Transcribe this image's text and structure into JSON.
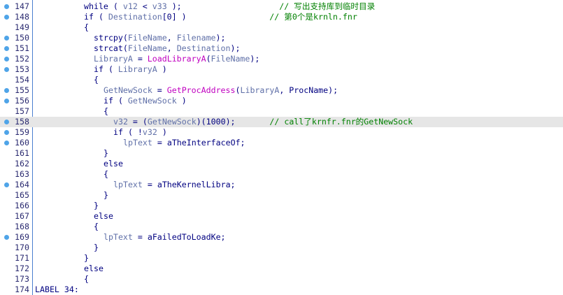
{
  "lines": [
    {
      "n": "147",
      "bp": true,
      "hl": false,
      "indent": 5,
      "tokens": [
        {
          "t": "while",
          "c": "k"
        },
        {
          "t": " ( ",
          "c": "p"
        },
        {
          "t": "v12",
          "c": "v"
        },
        {
          "t": " < ",
          "c": "p"
        },
        {
          "t": "v33",
          "c": "v"
        },
        {
          "t": " );",
          "c": "p"
        },
        {
          "t": "                    ",
          "c": "p"
        },
        {
          "t": "// 写出支持库到临时目录",
          "c": "c"
        }
      ]
    },
    {
      "n": "148",
      "bp": true,
      "hl": false,
      "indent": 5,
      "tokens": [
        {
          "t": "if",
          "c": "k"
        },
        {
          "t": " ( ",
          "c": "p"
        },
        {
          "t": "Destination",
          "c": "v"
        },
        {
          "t": "[0] )",
          "c": "p"
        },
        {
          "t": "                 ",
          "c": "p"
        },
        {
          "t": "// 第0个是krnln.fnr",
          "c": "c"
        }
      ]
    },
    {
      "n": "149",
      "bp": false,
      "hl": false,
      "indent": 5,
      "tokens": [
        {
          "t": "{",
          "c": "p"
        }
      ]
    },
    {
      "n": "150",
      "bp": true,
      "hl": false,
      "indent": 6,
      "tokens": [
        {
          "t": "strcpy",
          "c": "k"
        },
        {
          "t": "(",
          "c": "p"
        },
        {
          "t": "FileName",
          "c": "v"
        },
        {
          "t": ", ",
          "c": "p"
        },
        {
          "t": "Filename",
          "c": "v"
        },
        {
          "t": ");",
          "c": "p"
        }
      ]
    },
    {
      "n": "151",
      "bp": true,
      "hl": false,
      "indent": 6,
      "tokens": [
        {
          "t": "strcat",
          "c": "k"
        },
        {
          "t": "(",
          "c": "p"
        },
        {
          "t": "FileName",
          "c": "v"
        },
        {
          "t": ", ",
          "c": "p"
        },
        {
          "t": "Destination",
          "c": "v"
        },
        {
          "t": ");",
          "c": "p"
        }
      ]
    },
    {
      "n": "152",
      "bp": true,
      "hl": false,
      "indent": 6,
      "tokens": [
        {
          "t": "LibraryA",
          "c": "v"
        },
        {
          "t": " = ",
          "c": "p"
        },
        {
          "t": "LoadLibraryA",
          "c": "f"
        },
        {
          "t": "(",
          "c": "p"
        },
        {
          "t": "FileName",
          "c": "v"
        },
        {
          "t": ");",
          "c": "p"
        }
      ]
    },
    {
      "n": "153",
      "bp": true,
      "hl": false,
      "indent": 6,
      "tokens": [
        {
          "t": "if",
          "c": "k"
        },
        {
          "t": " ( ",
          "c": "p"
        },
        {
          "t": "LibraryA",
          "c": "v"
        },
        {
          "t": " )",
          "c": "p"
        }
      ]
    },
    {
      "n": "154",
      "bp": false,
      "hl": false,
      "indent": 6,
      "tokens": [
        {
          "t": "{",
          "c": "p"
        }
      ]
    },
    {
      "n": "155",
      "bp": true,
      "hl": false,
      "indent": 7,
      "tokens": [
        {
          "t": "GetNewSock",
          "c": "v"
        },
        {
          "t": " = ",
          "c": "p"
        },
        {
          "t": "GetProcAddress",
          "c": "f"
        },
        {
          "t": "(",
          "c": "p"
        },
        {
          "t": "LibraryA",
          "c": "v"
        },
        {
          "t": ", ",
          "c": "p"
        },
        {
          "t": "ProcName",
          "c": "k"
        },
        {
          "t": ");",
          "c": "p"
        }
      ]
    },
    {
      "n": "156",
      "bp": true,
      "hl": false,
      "indent": 7,
      "tokens": [
        {
          "t": "if",
          "c": "k"
        },
        {
          "t": " ( ",
          "c": "p"
        },
        {
          "t": "GetNewSock",
          "c": "v"
        },
        {
          "t": " )",
          "c": "p"
        }
      ]
    },
    {
      "n": "157",
      "bp": false,
      "hl": false,
      "indent": 7,
      "tokens": [
        {
          "t": "{",
          "c": "p"
        }
      ]
    },
    {
      "n": "158",
      "bp": true,
      "hl": true,
      "indent": 8,
      "tokens": [
        {
          "t": "v32",
          "c": "v"
        },
        {
          "t": " = (",
          "c": "p"
        },
        {
          "t": "GetNewSock",
          "c": "v"
        },
        {
          "t": ")(1000);",
          "c": "p"
        },
        {
          "t": "       ",
          "c": "p"
        },
        {
          "t": "// call了krnfr.fnr的GetNewSock",
          "c": "c"
        }
      ]
    },
    {
      "n": "159",
      "bp": true,
      "hl": false,
      "indent": 8,
      "tokens": [
        {
          "t": "if",
          "c": "k"
        },
        {
          "t": " ( !",
          "c": "p"
        },
        {
          "t": "v32",
          "c": "v"
        },
        {
          "t": " )",
          "c": "p"
        }
      ]
    },
    {
      "n": "160",
      "bp": true,
      "hl": false,
      "indent": 9,
      "tokens": [
        {
          "t": "lpText",
          "c": "v"
        },
        {
          "t": " = ",
          "c": "p"
        },
        {
          "t": "aTheInterfaceOf",
          "c": "k"
        },
        {
          "t": ";",
          "c": "p"
        }
      ]
    },
    {
      "n": "161",
      "bp": false,
      "hl": false,
      "indent": 7,
      "tokens": [
        {
          "t": "}",
          "c": "p"
        }
      ]
    },
    {
      "n": "162",
      "bp": false,
      "hl": false,
      "indent": 7,
      "tokens": [
        {
          "t": "else",
          "c": "k"
        }
      ]
    },
    {
      "n": "163",
      "bp": false,
      "hl": false,
      "indent": 7,
      "tokens": [
        {
          "t": "{",
          "c": "p"
        }
      ]
    },
    {
      "n": "164",
      "bp": true,
      "hl": false,
      "indent": 8,
      "tokens": [
        {
          "t": "lpText",
          "c": "v"
        },
        {
          "t": " = ",
          "c": "p"
        },
        {
          "t": "aTheKernelLibra",
          "c": "k"
        },
        {
          "t": ";",
          "c": "p"
        }
      ]
    },
    {
      "n": "165",
      "bp": false,
      "hl": false,
      "indent": 7,
      "tokens": [
        {
          "t": "}",
          "c": "p"
        }
      ]
    },
    {
      "n": "166",
      "bp": false,
      "hl": false,
      "indent": 6,
      "tokens": [
        {
          "t": "}",
          "c": "p"
        }
      ]
    },
    {
      "n": "167",
      "bp": false,
      "hl": false,
      "indent": 6,
      "tokens": [
        {
          "t": "else",
          "c": "k"
        }
      ]
    },
    {
      "n": "168",
      "bp": false,
      "hl": false,
      "indent": 6,
      "tokens": [
        {
          "t": "{",
          "c": "p"
        }
      ]
    },
    {
      "n": "169",
      "bp": true,
      "hl": false,
      "indent": 7,
      "tokens": [
        {
          "t": "lpText",
          "c": "v"
        },
        {
          "t": " = ",
          "c": "p"
        },
        {
          "t": "aFailedToLoadKe",
          "c": "k"
        },
        {
          "t": ";",
          "c": "p"
        }
      ]
    },
    {
      "n": "170",
      "bp": false,
      "hl": false,
      "indent": 6,
      "tokens": [
        {
          "t": "}",
          "c": "p"
        }
      ]
    },
    {
      "n": "171",
      "bp": false,
      "hl": false,
      "indent": 5,
      "tokens": [
        {
          "t": "}",
          "c": "p"
        }
      ]
    },
    {
      "n": "172",
      "bp": false,
      "hl": false,
      "indent": 5,
      "tokens": [
        {
          "t": "else",
          "c": "k"
        }
      ]
    },
    {
      "n": "173",
      "bp": false,
      "hl": false,
      "indent": 5,
      "tokens": [
        {
          "t": "{",
          "c": "p"
        }
      ]
    },
    {
      "n": "174",
      "bp": false,
      "hl": false,
      "indent": 0,
      "tokens": [
        {
          "t": "LABEL 34:",
          "c": "k"
        }
      ]
    }
  ],
  "colors": {
    "keyword": "#000080",
    "variable": "#6070a8",
    "function": "#c000c0",
    "comment": "#008000",
    "highlight": "#e6e6e6",
    "breakpoint_dot": "#4fa4e8",
    "gutter_border": "#4a7fd0"
  }
}
